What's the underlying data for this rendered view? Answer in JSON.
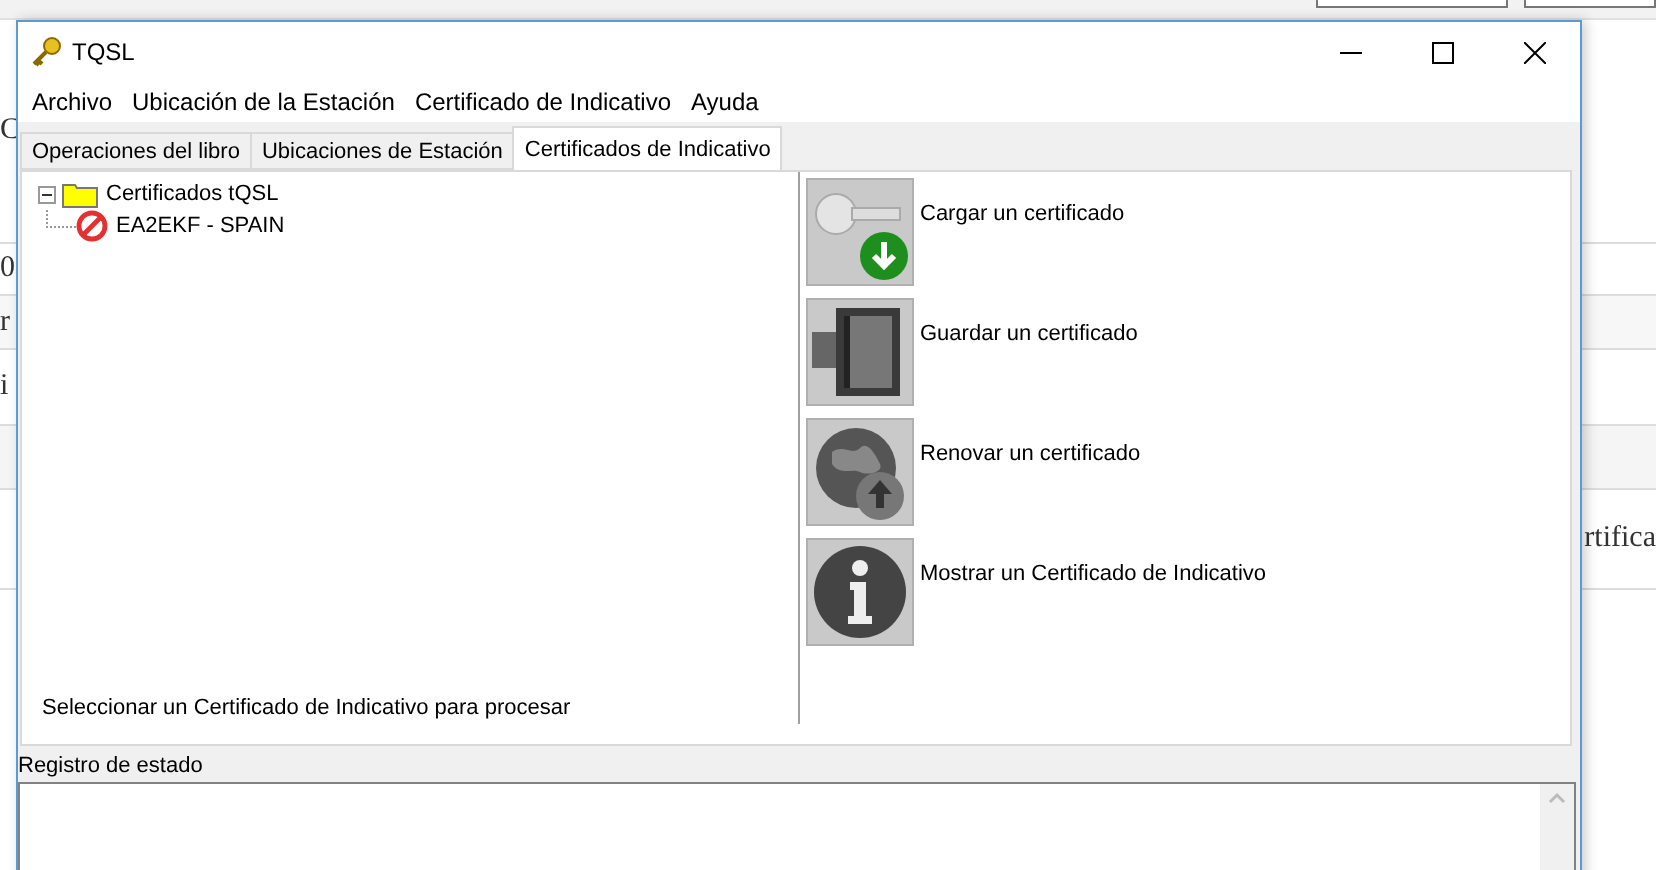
{
  "background": {
    "left_fragments": [
      "C",
      "0",
      "r",
      "i"
    ],
    "right_fragments": [
      "rtifica"
    ]
  },
  "window": {
    "title": "TQSL"
  },
  "menu": [
    "Archivo",
    "Ubicación de la Estación",
    "Certificado de Indicativo",
    "Ayuda"
  ],
  "tabs": [
    {
      "label": "Operaciones del libro",
      "selected": false
    },
    {
      "label": "Ubicaciones de Estación",
      "selected": false
    },
    {
      "label": "Certificados de Indicativo",
      "selected": true
    }
  ],
  "tree": {
    "label": "Certificados tQSL",
    "expanded": true,
    "children": [
      {
        "label": "EA2EKF - SPAIN",
        "kind": "invalid"
      }
    ]
  },
  "actions": [
    {
      "label": "Cargar un certificado",
      "kind": "load"
    },
    {
      "label": "Guardar un certificado",
      "kind": "save"
    },
    {
      "label": "Renovar un certificado",
      "kind": "renew"
    },
    {
      "label": "Mostrar un Certificado de Indicativo",
      "kind": "info"
    }
  ],
  "hint": "Seleccionar un Certificado de Indicativo para procesar",
  "log": {
    "label": "Registro de estado"
  }
}
